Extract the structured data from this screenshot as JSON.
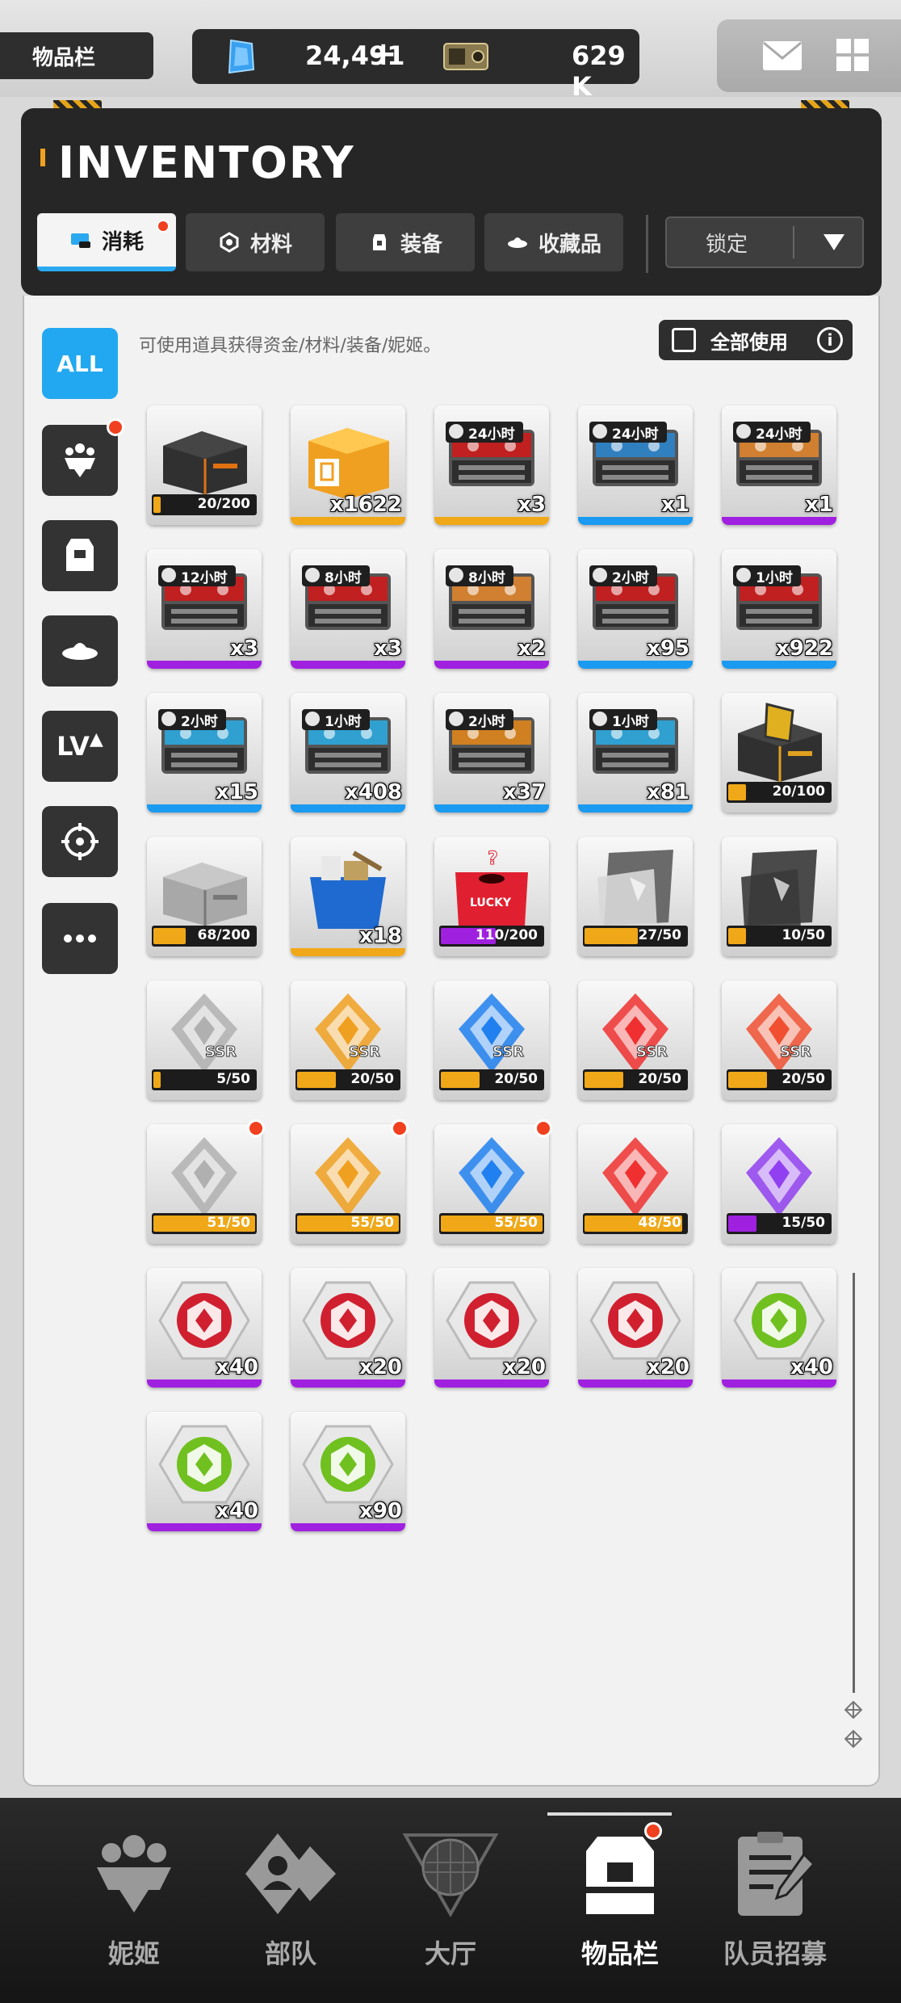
{
  "top": {
    "screen_title": "物品栏",
    "gems": "24,491",
    "plus": "+",
    "credits": "629 K"
  },
  "header": {
    "title": "INVENTORY",
    "tabs": [
      {
        "label": "消耗",
        "icon": "consumable-icon"
      },
      {
        "label": "材料",
        "icon": "material-icon"
      },
      {
        "label": "装备",
        "icon": "equipment-icon"
      },
      {
        "label": "收藏品",
        "icon": "collectible-icon"
      }
    ],
    "lock_select": "锁定"
  },
  "sidebar": {
    "all_label": "ALL",
    "lv_label": "LV"
  },
  "hint": "可使用道具获得资金/材料/装备/妮姬。",
  "use_all": "全部使用",
  "colors": {
    "accent": "#22a8f0",
    "rarity_gold": "#f0a818",
    "rarity_purple": "#a020e0",
    "rarity_blue": "#1a9af0"
  },
  "items": [
    {
      "kind": "darkbox",
      "rarity": "none",
      "progress": "20/200",
      "ratio": 0.1,
      "bar": "gold"
    },
    {
      "kind": "orangebox",
      "rarity": "gold",
      "count": "x1622"
    },
    {
      "kind": "case",
      "rarity": "gold",
      "timer": "24小时",
      "count": "x3",
      "lining": "#c02020"
    },
    {
      "kind": "case",
      "rarity": "blue",
      "timer": "24小时",
      "count": "x1",
      "lining": "#3080c0"
    },
    {
      "kind": "case",
      "rarity": "purple",
      "timer": "24小时",
      "count": "x1",
      "lining": "#d08030"
    },
    {
      "kind": "case",
      "rarity": "purple",
      "timer": "12小时",
      "count": "x3",
      "lining": "#c02020"
    },
    {
      "kind": "case",
      "rarity": "purple",
      "timer": "8小时",
      "count": "x3",
      "lining": "#c02020"
    },
    {
      "kind": "case",
      "rarity": "purple",
      "timer": "8小时",
      "count": "x2",
      "lining": "#d08030"
    },
    {
      "kind": "case",
      "rarity": "blue",
      "timer": "2小时",
      "count": "x95",
      "lining": "#c02020"
    },
    {
      "kind": "case",
      "rarity": "blue",
      "timer": "1小时",
      "count": "x922",
      "lining": "#c02020"
    },
    {
      "kind": "case",
      "rarity": "blue",
      "timer": "2小时",
      "count": "x15",
      "lining": "#30a0d0"
    },
    {
      "kind": "case",
      "rarity": "blue",
      "timer": "1小时",
      "count": "x408",
      "lining": "#30a0d0"
    },
    {
      "kind": "case",
      "rarity": "blue",
      "timer": "2小时",
      "count": "x37",
      "lining": "#d08020"
    },
    {
      "kind": "case",
      "rarity": "blue",
      "timer": "1小时",
      "count": "x81",
      "lining": "#30a0d0"
    },
    {
      "kind": "goldcase",
      "rarity": "none",
      "progress": "20/100",
      "ratio": 0.2,
      "bar": "gold"
    },
    {
      "kind": "greybox",
      "rarity": "none",
      "progress": "68/200",
      "ratio": 0.34,
      "bar": "gold"
    },
    {
      "kind": "bluebin",
      "rarity": "gold",
      "count": "x18"
    },
    {
      "kind": "luckybox",
      "rarity": "none",
      "progress": "110/200",
      "ratio": 0.55,
      "bar": "purple"
    },
    {
      "kind": "card",
      "rarity": "none",
      "progress": "27/50",
      "ratio": 0.54,
      "bar": "gold"
    },
    {
      "kind": "card2",
      "rarity": "none",
      "progress": "10/50",
      "ratio": 0.2,
      "bar": "gold"
    },
    {
      "kind": "crystal",
      "rarity": "none",
      "progress": "5/50",
      "ratio": 0.1,
      "bar": "gold",
      "color": "#b0b0b0",
      "sub": "SSR"
    },
    {
      "kind": "crystal",
      "rarity": "none",
      "progress": "20/50",
      "ratio": 0.4,
      "bar": "gold",
      "color": "#f0a020",
      "sub": "SSR"
    },
    {
      "kind": "crystal",
      "rarity": "none",
      "progress": "20/50",
      "ratio": 0.4,
      "bar": "gold",
      "color": "#2080f0",
      "sub": "SSR"
    },
    {
      "kind": "crystal",
      "rarity": "none",
      "progress": "20/50",
      "ratio": 0.4,
      "bar": "gold",
      "color": "#f03030",
      "sub": "SSR"
    },
    {
      "kind": "crystal",
      "rarity": "none",
      "progress": "20/50",
      "ratio": 0.4,
      "bar": "gold",
      "color": "#f05030",
      "sub": "SSR"
    },
    {
      "kind": "crystal",
      "rarity": "none",
      "progress": "51/50",
      "ratio": 1.0,
      "bar": "gold",
      "color": "#b0b0b0",
      "dot": true
    },
    {
      "kind": "crystal",
      "rarity": "none",
      "progress": "55/50",
      "ratio": 1.0,
      "bar": "gold",
      "color": "#f0a020",
      "dot": true
    },
    {
      "kind": "crystal",
      "rarity": "none",
      "progress": "55/50",
      "ratio": 1.0,
      "bar": "gold",
      "color": "#2080f0",
      "dot": true
    },
    {
      "kind": "crystal",
      "rarity": "none",
      "progress": "48/50",
      "ratio": 0.96,
      "bar": "gold",
      "color": "#f03030"
    },
    {
      "kind": "crystal",
      "rarity": "none",
      "progress": "15/50",
      "ratio": 0.3,
      "bar": "purple",
      "color": "#9040f0"
    },
    {
      "kind": "badge",
      "rarity": "purple",
      "count": "x40",
      "color": "#d02030"
    },
    {
      "kind": "badge",
      "rarity": "purple",
      "count": "x20",
      "color": "#d02030"
    },
    {
      "kind": "badge",
      "rarity": "purple",
      "count": "x20",
      "color": "#d02030"
    },
    {
      "kind": "badge",
      "rarity": "purple",
      "count": "x20",
      "color": "#d02030"
    },
    {
      "kind": "badge",
      "rarity": "purple",
      "count": "x40",
      "color": "#70c020"
    },
    {
      "kind": "badge",
      "rarity": "purple",
      "count": "x40",
      "color": "#70c020"
    },
    {
      "kind": "badge",
      "rarity": "purple",
      "count": "x90",
      "color": "#70c020"
    }
  ],
  "nav": [
    {
      "label": "妮姬",
      "icon": "nikke-icon"
    },
    {
      "label": "部队",
      "icon": "squad-icon"
    },
    {
      "label": "大厅",
      "icon": "lobby-icon"
    },
    {
      "label": "物品栏",
      "icon": "inventory-icon",
      "active": true
    },
    {
      "label": "队员招募",
      "icon": "recruit-icon"
    }
  ]
}
